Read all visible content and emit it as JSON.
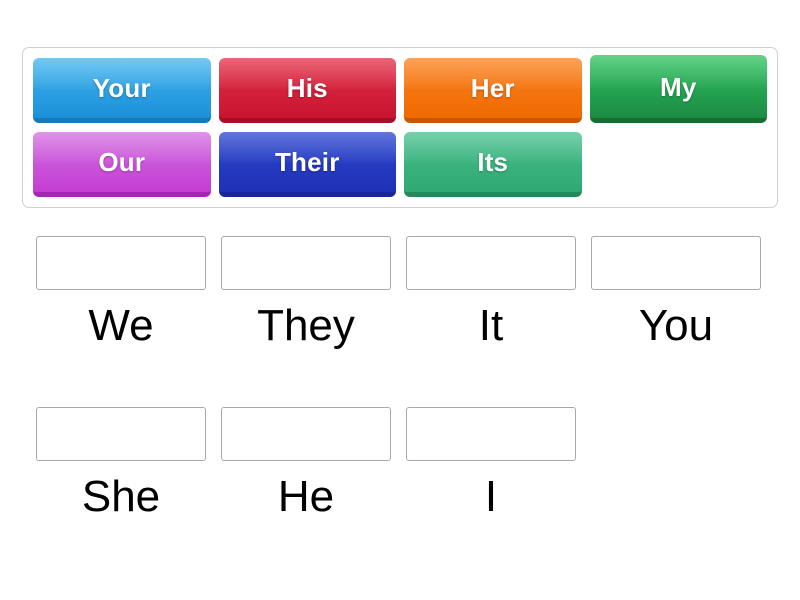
{
  "activity": {
    "type": "match-up-drag-and-drop",
    "tile_bank": {
      "rows": [
        [
          {
            "label": "Your",
            "color_top": "#44b5ee",
            "color_bottom": "#1b90da",
            "color_edge": "#1679b8",
            "state": "normal"
          },
          {
            "label": "His",
            "color_top": "#e23149",
            "color_bottom": "#c81430",
            "color_edge": "#a70f27",
            "state": "normal"
          },
          {
            "label": "Her",
            "color_top": "#fa8221",
            "color_bottom": "#f06a00",
            "color_edge": "#c95800",
            "state": "normal"
          },
          {
            "label": "My",
            "color_top": "#2ec25f",
            "color_bottom": "#1d8b44",
            "color_edge": "#15702f",
            "state": "raised"
          }
        ],
        [
          {
            "label": "Our",
            "color_top": "#d36ee1",
            "color_bottom": "#c33ed2",
            "color_edge": "#a526b4",
            "state": "normal"
          },
          {
            "label": "Their",
            "color_top": "#2c46cf",
            "color_bottom": "#1e31b6",
            "color_edge": "#17269a",
            "state": "normal"
          },
          {
            "label": "Its",
            "color_top": "#47c08c",
            "color_bottom": "#2fa873",
            "color_edge": "#238a5c",
            "state": "normal"
          },
          {
            "label": "",
            "color_top": "",
            "color_bottom": "",
            "color_edge": "",
            "state": "empty"
          }
        ]
      ]
    },
    "dropzone_rows": [
      [
        {
          "word": "We",
          "answer": ""
        },
        {
          "word": "They",
          "answer": ""
        },
        {
          "word": "It",
          "answer": ""
        },
        {
          "word": "You",
          "answer": ""
        }
      ],
      [
        {
          "word": "She",
          "answer": ""
        },
        {
          "word": "He",
          "answer": ""
        },
        {
          "word": "I",
          "answer": ""
        },
        {
          "word": "",
          "answer": "",
          "blank": true
        }
      ]
    ]
  }
}
